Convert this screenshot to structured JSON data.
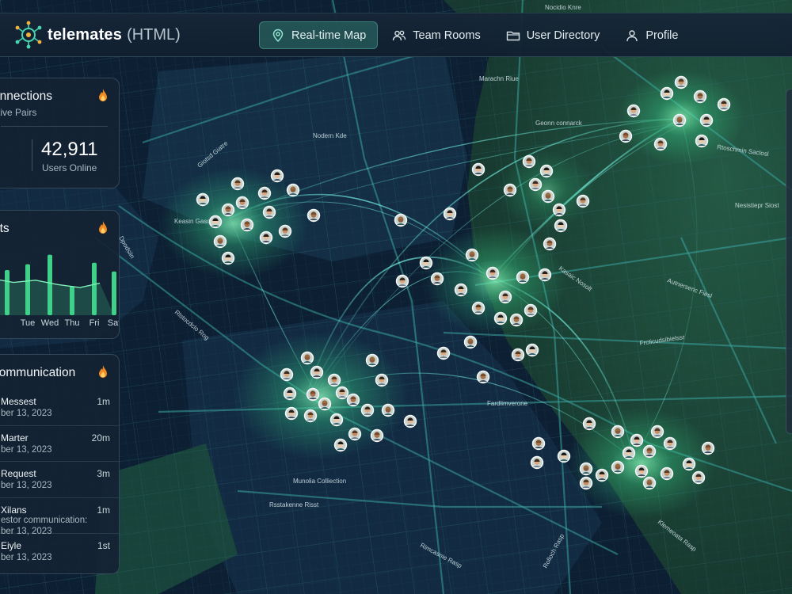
{
  "map": {
    "labels": [
      {
        "text": "Nocidio Knre",
        "rot": 0
      },
      {
        "text": "Marachn Riue",
        "rot": 0
      },
      {
        "text": "Geonn connarck",
        "rot": 0
      },
      {
        "text": "Nodern Kde",
        "rot": 0
      },
      {
        "text": "Rtoschmin Saclosl",
        "rot": 8
      },
      {
        "text": "Nesistiepr Siost",
        "rot": 0
      },
      {
        "text": "Autnerseric Fiesl",
        "rot": 20
      },
      {
        "text": "Frcticudsibielssr",
        "rot": -8
      },
      {
        "text": "Fardlimverone",
        "rot": 0
      },
      {
        "text": "Munolia Colliection",
        "rot": 0
      },
      {
        "text": "Rsstakenne Risst",
        "rot": 0
      },
      {
        "text": "Rimcasnie Rasp",
        "rot": 28
      },
      {
        "text": "Rolloch Rasp",
        "rot": -62
      },
      {
        "text": "Klemeoata Rasp",
        "rot": 38
      },
      {
        "text": "Rlstocdclo Rog",
        "rot": 40
      },
      {
        "text": "Kasaic Nosolt",
        "rot": 35
      },
      {
        "text": "Giotsd Giatre",
        "rot": -40
      },
      {
        "text": "Keasin Gaso",
        "rot": 0
      },
      {
        "text": "Dpodsiin",
        "rot": 60
      }
    ]
  },
  "app": {
    "name": "telemates",
    "suffix": "(HTML)"
  },
  "nav": [
    {
      "label": "Real-time Map",
      "icon": "map-pin-icon",
      "active": true
    },
    {
      "label": "Team Rooms",
      "icon": "users-icon",
      "active": false
    },
    {
      "label": "User Directory",
      "icon": "folder-icon",
      "active": false
    },
    {
      "label": "Profile",
      "icon": "person-icon",
      "active": false
    }
  ],
  "connections_panel": {
    "title": "onnections",
    "subtitle": "ctive Pairs",
    "left_fragment": "s",
    "stat_value": "42,911",
    "stat_label": "Users Online"
  },
  "stats_panel": {
    "title": "ats",
    "chart_data": {
      "type": "bar",
      "categories": [
        "",
        "Tue",
        "Wed",
        "Thu",
        "Fri",
        "Sat"
      ],
      "values": [
        62,
        70,
        83,
        40,
        72,
        60
      ],
      "line_values": [
        50,
        45,
        48,
        42,
        38,
        44
      ],
      "accent": "#3fd18a"
    }
  },
  "comm_panel": {
    "title": "communication",
    "items": [
      {
        "name": "Messest",
        "time": "1m",
        "date": "ber 13, 2023",
        "extra": ""
      },
      {
        "name": "Marter",
        "time": "20m",
        "date": "ber 13, 2023",
        "extra": ""
      },
      {
        "name": "Request",
        "time": "3m",
        "date": "ber 13, 2023",
        "extra": ""
      },
      {
        "name": "Xilans",
        "time": "1m",
        "date": "ber 13, 2023",
        "extra": "estor communication:"
      },
      {
        "name": "Eiyle",
        "time": "1st",
        "date": "ber 13, 2023",
        "extra": ""
      }
    ]
  },
  "colors": {
    "background": "#0b1a2b",
    "land_green": "#1c4a3a",
    "water": "#0e2236",
    "route": "#4be3c8",
    "glow": "#5dffb0"
  }
}
